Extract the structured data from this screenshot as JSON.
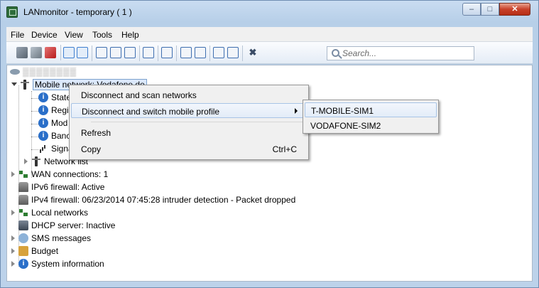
{
  "window": {
    "title": "LANmonitor - temporary ( 1 )",
    "controls": {
      "minimize": "–",
      "maximize": "□",
      "close": "✕"
    }
  },
  "menubar": [
    "File",
    "Device",
    "View",
    "Tools",
    "Help"
  ],
  "toolbar": {
    "icons": [
      "connect-icon",
      "disconnect-icon",
      "delete-icon",
      "view-icon",
      "view-alt-icon",
      "network-icon",
      "grid-icon",
      "device-icon",
      "list-icon",
      "monitor-icon",
      "search-device-icon",
      "chart-icon",
      "settings-icon",
      "graph-icon",
      "close-x-icon"
    ],
    "search_placeholder": "Search..."
  },
  "tree": {
    "device_name": "▒▒▒▒▒▒▒▒",
    "mobile_network": "Mobile network: Vodafone.de",
    "children": [
      "State",
      "Regi",
      "Mod",
      "Banc",
      "Signa"
    ],
    "network_list": "Network list",
    "items": [
      "WAN connections: 1",
      "IPv6 firewall: Active",
      "IPv4 firewall: 06/23/2014 07:45:28 intruder detection - Packet dropped",
      "Local networks",
      "DHCP server: Inactive",
      "SMS messages",
      "Budget",
      "System information"
    ]
  },
  "context_menu": {
    "items": [
      {
        "label": "Disconnect and scan networks"
      },
      {
        "label": "Disconnect and switch mobile profile"
      },
      {
        "label": "Refresh"
      },
      {
        "label": "Copy",
        "shortcut": "Ctrl+C"
      }
    ],
    "submenu": [
      "T-MOBILE-SIM1",
      "VODAFONE-SIM2"
    ]
  },
  "colors": {
    "selection": "#dbe8fb",
    "selection_border": "#7da2ce",
    "chrome": "#bcd2ea"
  }
}
